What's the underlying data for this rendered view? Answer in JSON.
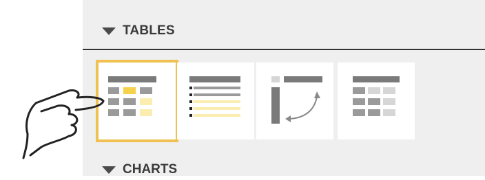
{
  "sections": {
    "tables_label": "TABLES",
    "charts_label": "CHARTS"
  },
  "tiles": [
    {
      "name": "table-layout-highlight",
      "selected": true
    },
    {
      "name": "table-layout-list",
      "selected": false
    },
    {
      "name": "table-layout-pivot",
      "selected": false
    },
    {
      "name": "table-layout-grid",
      "selected": false
    }
  ],
  "colors": {
    "accent": "#f0c050",
    "header_gray": "#7a7a7a",
    "cell_gray": "#9a9a9a",
    "light_cell": "#d6d6d6",
    "highlight_yellow": "#f6d24a",
    "pale_yellow": "#fbedb0"
  },
  "icons": [
    "chevron-down-icon",
    "hand-pointer-icon"
  ]
}
